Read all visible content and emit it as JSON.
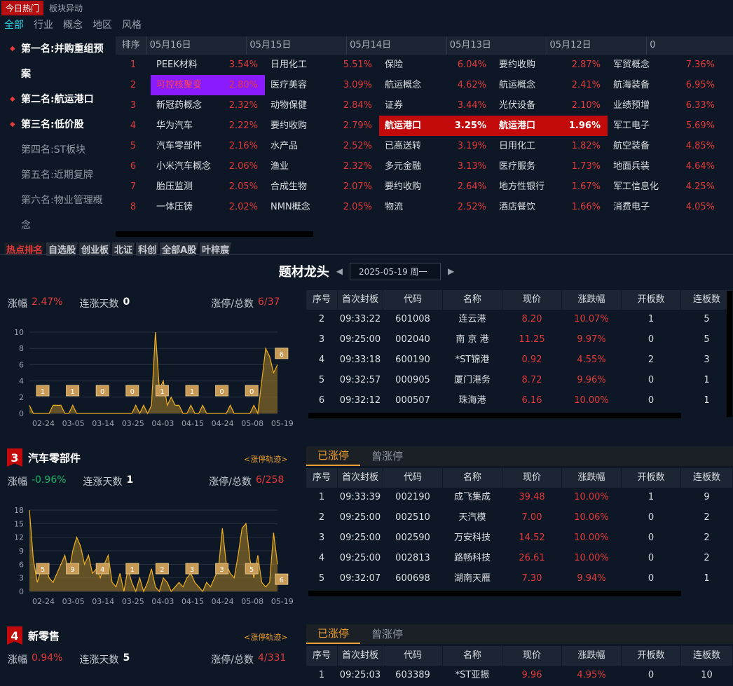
{
  "top_tabs": [
    "今日热门",
    "板块异动"
  ],
  "filters": [
    "全部",
    "行业",
    "概念",
    "地区",
    "风格"
  ],
  "ranks": [
    {
      "label": "第一名:并购重组预",
      "cont": "案",
      "top": true
    },
    {
      "label": "第二名:航运港口",
      "top": true
    },
    {
      "label": "第三名:低价股",
      "top": true
    },
    {
      "label": "第四名:ST板块",
      "top": false
    },
    {
      "label": "第五名:近期复牌",
      "top": false
    },
    {
      "label": "第六名:物业管理概",
      "cont": "念",
      "top": false
    }
  ],
  "grid": {
    "rank_header": "排序",
    "dates": [
      "05月16日",
      "05月15日",
      "05月14日",
      "05月13日",
      "05月12日",
      "0"
    ],
    "rows": [
      [
        [
          "PEEK材料",
          "3.54%"
        ],
        [
          "日用化工",
          "5.51%"
        ],
        [
          "保险",
          "6.04%"
        ],
        [
          "要约收购",
          "2.87%"
        ],
        [
          "军贸概念",
          "7.36%"
        ]
      ],
      [
        [
          "可控核聚变",
          "2.80%"
        ],
        [
          "医疗美容",
          "3.09%"
        ],
        [
          "航运概念",
          "4.62%"
        ],
        [
          "航运概念",
          "2.41%"
        ],
        [
          "航海装备",
          "6.95%"
        ]
      ],
      [
        [
          "新冠药概念",
          "2.32%"
        ],
        [
          "动物保健",
          "2.84%"
        ],
        [
          "证券",
          "3.44%"
        ],
        [
          "光伏设备",
          "2.10%"
        ],
        [
          "业绩预增",
          "6.33%"
        ]
      ],
      [
        [
          "华为汽车",
          "2.22%"
        ],
        [
          "要约收购",
          "2.79%"
        ],
        [
          "航运港口",
          "3.25%"
        ],
        [
          "航运港口",
          "1.96%"
        ],
        [
          "军工电子",
          "5.69%"
        ]
      ],
      [
        [
          "汽车零部件",
          "2.16%"
        ],
        [
          "水产品",
          "2.52%"
        ],
        [
          "已高送转",
          "3.19%"
        ],
        [
          "日用化工",
          "1.82%"
        ],
        [
          "航空装备",
          "4.85%"
        ]
      ],
      [
        [
          "小米汽车概念",
          "2.06%"
        ],
        [
          "渔业",
          "2.32%"
        ],
        [
          "多元金融",
          "3.13%"
        ],
        [
          "医疗服务",
          "1.73%"
        ],
        [
          "地面兵装",
          "4.64%"
        ]
      ],
      [
        [
          "胎压监测",
          "2.05%"
        ],
        [
          "合成生物",
          "2.07%"
        ],
        [
          "要约收购",
          "2.64%"
        ],
        [
          "地方性银行",
          "1.67%"
        ],
        [
          "军工信息化",
          "4.25%"
        ]
      ],
      [
        [
          "一体压铸",
          "2.02%"
        ],
        [
          "NMN概念",
          "2.05%"
        ],
        [
          "物流",
          "2.52%"
        ],
        [
          "酒店餐饮",
          "1.66%"
        ],
        [
          "消费电子",
          "4.05%"
        ]
      ]
    ]
  },
  "sub_tabs": [
    "热点排名",
    "自选股",
    "创业板",
    "北证",
    "科创",
    "全部A股",
    "叶梓宸"
  ],
  "header": {
    "title": "题材龙头",
    "date": "2025-05-19 周一"
  },
  "labels": {
    "zf": "涨幅",
    "lz": "连涨天数",
    "zt": "涨停/总数",
    "track": "<涨停轨迹>",
    "tab_on": "已涨停",
    "tab_off": "曾涨停"
  },
  "table_headers": [
    "序号",
    "首次封板",
    "代码",
    "名称",
    "现价",
    "涨跌幅",
    "开板数",
    "连板数"
  ],
  "panel1": {
    "zf": "2.47%",
    "lz": "0",
    "zt": "6/37",
    "rows": [
      [
        "2",
        "09:33:22",
        "601008",
        "连云港",
        "8.20",
        "10.07%",
        "1",
        "5"
      ],
      [
        "3",
        "09:25:00",
        "002040",
        "南 京 港",
        "11.25",
        "9.97%",
        "0",
        "5"
      ],
      [
        "4",
        "09:33:18",
        "600190",
        "*ST锦港",
        "0.92",
        "4.55%",
        "2",
        "3"
      ],
      [
        "5",
        "09:32:57",
        "000905",
        "厦门港务",
        "8.72",
        "9.96%",
        "0",
        "1"
      ],
      [
        "6",
        "09:32:12",
        "000507",
        "珠海港",
        "6.16",
        "10.00%",
        "0",
        "1"
      ]
    ]
  },
  "panel3": {
    "rank": "3",
    "name": "汽车零部件",
    "zf": "-0.96%",
    "lz": "1",
    "zt": "6/258",
    "rows": [
      [
        "1",
        "09:33:39",
        "002190",
        "成飞集成",
        "39.48",
        "10.00%",
        "1",
        "9"
      ],
      [
        "2",
        "09:25:00",
        "002510",
        "天汽模",
        "7.00",
        "10.06%",
        "0",
        "2"
      ],
      [
        "3",
        "09:25:00",
        "002590",
        "万安科技",
        "14.52",
        "10.00%",
        "0",
        "2"
      ],
      [
        "4",
        "09:25:00",
        "002813",
        "路畅科技",
        "26.61",
        "10.00%",
        "0",
        "2"
      ],
      [
        "5",
        "09:32:07",
        "600698",
        "湖南天雁",
        "7.30",
        "9.94%",
        "0",
        "1"
      ]
    ]
  },
  "panel4": {
    "rank": "4",
    "name": "新零售",
    "zf": "0.94%",
    "lz": "5",
    "zt": "4/331",
    "rows": [
      [
        "1",
        "09:25:03",
        "603389",
        "*ST亚振",
        "9.96",
        "4.95%",
        "0",
        "10"
      ]
    ]
  },
  "chart_data": [
    {
      "type": "area",
      "x_ticks": [
        "02-24",
        "03-05",
        "03-14",
        "03-25",
        "04-03",
        "04-15",
        "04-24",
        "05-08",
        "05-19"
      ],
      "y_ticks": [
        0,
        2,
        4,
        6,
        8,
        10
      ],
      "ylim": [
        0,
        10
      ],
      "values": [
        1,
        0,
        0,
        0,
        0,
        0,
        1,
        1,
        1,
        0,
        0,
        1,
        0,
        0,
        0,
        0,
        0,
        0,
        0,
        0,
        0,
        0,
        0,
        0,
        0,
        0,
        0,
        1,
        0,
        1,
        0,
        1,
        10,
        3,
        4,
        1,
        2,
        1,
        1,
        0,
        0,
        1,
        0,
        0,
        1,
        0,
        0,
        0,
        0,
        0,
        0,
        1,
        0,
        0,
        0,
        0,
        0,
        1,
        0,
        4,
        8,
        7,
        5,
        6
      ],
      "labels": [
        "1",
        "1",
        "0",
        "0",
        "1",
        "1",
        "0",
        "0",
        "6"
      ]
    },
    {
      "type": "area",
      "x_ticks": [
        "02-24",
        "03-05",
        "03-14",
        "03-25",
        "04-03",
        "04-15",
        "04-24",
        "05-08",
        "05-19"
      ],
      "y_ticks": [
        0,
        3,
        6,
        9,
        12,
        15,
        18
      ],
      "ylim": [
        0,
        18
      ],
      "values": [
        18,
        7,
        2,
        5,
        6,
        3,
        2,
        4,
        6,
        8,
        4,
        9,
        12,
        10,
        6,
        8,
        4,
        5,
        3,
        6,
        8,
        2,
        1,
        4,
        0,
        5,
        2,
        0,
        3,
        0,
        2,
        5,
        1,
        0,
        3,
        2,
        0,
        1,
        2,
        1,
        3,
        4,
        2,
        1,
        0,
        2,
        1,
        3,
        5,
        14,
        6,
        4,
        3,
        8,
        14,
        15,
        7,
        3,
        8,
        2,
        1,
        2,
        13,
        6
      ],
      "labels": [
        "5",
        "9",
        "4",
        "1",
        "2",
        "3",
        "3",
        "5",
        "6"
      ]
    }
  ]
}
